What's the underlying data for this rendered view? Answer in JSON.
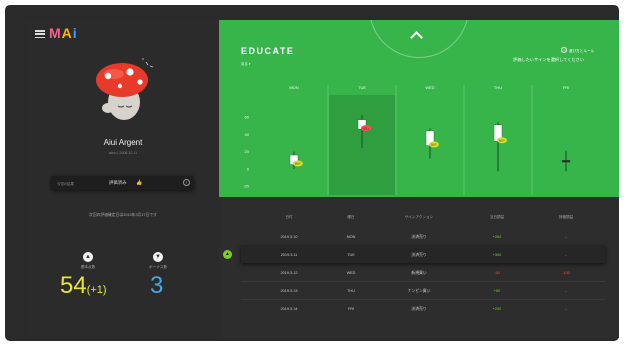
{
  "app": {
    "logo": [
      "M",
      "A",
      "i"
    ]
  },
  "user": {
    "name": "Aiui Argent",
    "id": "aiiuo | 2008.12.11"
  },
  "status": {
    "label": "今週の結果",
    "value": "評価済み",
    "thumb": "👍"
  },
  "notice": "次回の評価確定日は2019年3月17日です",
  "stats": [
    {
      "label": "基本点数",
      "value": "54",
      "bonus": "(+1)",
      "color": "#e8e63a",
      "icon": "thumb-up-icon"
    },
    {
      "label": "ボーナス数",
      "value": "3",
      "color": "#44a8e8",
      "icon": "thumb-down-icon"
    }
  ],
  "panel": {
    "title": "EDUCATE",
    "back": "戻る ▾",
    "howto": "遊び方とルール",
    "instruction": "評価したいサインを選択してください"
  },
  "chart_data": {
    "type": "candlestick",
    "categories": [
      "MON",
      "TUE",
      "WED",
      "THU",
      "FRI"
    ],
    "y_ticks": [
      60,
      40,
      20,
      0,
      -20
    ],
    "ylim": [
      -28,
      74
    ],
    "grid": false,
    "selected_index": 1,
    "series": [
      {
        "low": 0,
        "high": 20,
        "open": 16,
        "close": 5,
        "label": "BUY",
        "label_color": "#d4e02a"
      },
      {
        "low": 24,
        "high": 62,
        "open": 57,
        "close": 46,
        "label": "SELL",
        "label_color": "#ff4c4c"
      },
      {
        "low": 12,
        "high": 47,
        "open": 44,
        "close": 27,
        "label": "BUY",
        "label_color": "#d4e02a"
      },
      {
        "low": -3,
        "high": 54,
        "open": 51,
        "close": 32,
        "label": "BUY",
        "label_color": "#d4e02a"
      },
      {
        "low": -3,
        "high": 21,
        "open": 10,
        "close": 10,
        "label": "",
        "label_color": ""
      }
    ],
    "body_colors": {
      "up": "#ffffff",
      "down": "#2c2c2c"
    }
  },
  "table": {
    "headers": [
      "日付",
      "曜日",
      "サインアクション",
      "当日損益",
      "評価損益"
    ],
    "rows": [
      {
        "date": "2019.3.10",
        "day": "MON",
        "action": "決済売り",
        "pnl": "+264",
        "eval": "-",
        "pnl_class": "pos"
      },
      {
        "date": "2019.3.11",
        "day": "TUE",
        "action": "決済売り",
        "pnl": "+300",
        "eval": "-",
        "pnl_class": "pos",
        "highlight": true
      },
      {
        "date": "2019.3.12",
        "day": "WED",
        "action": "新規買い",
        "pnl": "-90",
        "eval": "-100",
        "pnl_class": "neg"
      },
      {
        "date": "2019.3.13",
        "day": "THU",
        "action": "ナンピン買い",
        "pnl": "+80",
        "eval": "-",
        "pnl_class": "pos"
      },
      {
        "date": "2019.3.14",
        "day": "FRI",
        "action": "決済売り",
        "pnl": "+200",
        "eval": "-",
        "pnl_class": "pos"
      }
    ]
  }
}
